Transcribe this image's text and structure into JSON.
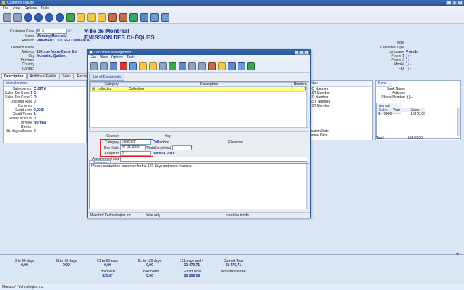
{
  "window": {
    "title": "Customer Inquiry",
    "menu": [
      "File",
      "View",
      "Options",
      "Tools"
    ],
    "status": "Maestro* Technologies inc."
  },
  "customer": {
    "code_label": "Customer Code",
    "code": "MTL",
    "status_label": "Status",
    "status": "Warning Manually",
    "reason_label": "Reason",
    "reason": "PAIEMENT COD RECOMMANDÉ",
    "name": "Ville de Montréal",
    "subtitle": "ÉMISSION DES CHÈQUES",
    "owner_label": "Owner's Name",
    "address_label": "Address",
    "address": "155, rue Notre-Dame Est",
    "city_label": "City",
    "city": "Montréal, Québec",
    "province_label": "Province",
    "country_label": "Country",
    "contact_label": "Contact",
    "note_label": "Note",
    "type_label": "Customer Type",
    "language_label": "Language",
    "language": "French",
    "phone1_label": "Phone 1",
    "phone1": "(   )   -",
    "phone2_label": "Phone 2",
    "phone2": "(   )   -",
    "mobile_label": "Mobile",
    "mobile": "(   )   -",
    "fax_label": "Fax",
    "fax": "(   )   -"
  },
  "tabs": [
    "Description",
    "Additional Fields",
    "Sales",
    "Receipts",
    "Or"
  ],
  "misc": {
    "header": "Miscellaneous",
    "salesperson_label": "Salesperson",
    "salesperson": "CUSTM",
    "taxcode1_label": "Sales Tax Code 1",
    "taxcode1": "C",
    "taxcode2_label": "Sales Tax Code 2",
    "taxcode2": "D",
    "discount_label": "Discount Rate",
    "discount": "0",
    "currency_label": "Currency",
    "credit_label": "Credit Limit",
    "credit": "0,00 $",
    "terms_label": "Credit Terms",
    "terms": "1",
    "account_label": "Default Account",
    "account": "0",
    "invoice_label": "Invoice",
    "invoice": "Normal",
    "region_label": "Region",
    "days_label": "Nb. days allowed",
    "days": "0"
  },
  "numbers": {
    "header": "nber",
    "items": [
      "BQ Number",
      "SST Number",
      "CQ Number",
      "GST Number",
      "PST Number"
    ],
    "dates": [
      "ssation Date",
      "uation Date"
    ]
  },
  "bank": {
    "header": "Bank",
    "name_label": "Bank Name",
    "address_label": "Address",
    "phone_label": "Phone Number",
    "phone": "(   )   -",
    "annual_header": "Annual Sales",
    "col_year": "Year",
    "col_sales": "Sales",
    "row_num": "1",
    "row_year": "2006",
    "row_sales": "19870,00",
    "total_label": "Total",
    "total": "19870,00"
  },
  "aging": {
    "c0_label": "0 to 30 days",
    "c0": "0,00",
    "c1_label": "31 to 60 days",
    "c1": "0,00",
    "c2_label": "61 to 90 days",
    "c2": "0,00",
    "c3_label": "91 to 120 days",
    "c3": "0,00",
    "c4_label": "121 days and +",
    "c4": "21 470,71",
    "c5_label": "Current Total",
    "c5": "21 470,71",
    "holdback_label": "Holdback",
    "holdback": "825,87",
    "onaccount_label": "On Account",
    "onaccount": "0,00",
    "grand_label": "Grand Total",
    "grand": "22 296,58",
    "nontrans_label": "Non-transferred"
  },
  "dialog": {
    "title": "Document Management",
    "menu": [
      "File",
      "View",
      "Options",
      "Tools"
    ],
    "grid_headers": [
      "Category",
      "Description",
      "Number"
    ],
    "row": {
      "category": "collection",
      "description": "Collection",
      "number": "1"
    },
    "list_title": "List of Documents",
    "counter_label": "Counter",
    "key_label": "Key",
    "key": "Collection",
    "category_label": "Category",
    "category": "collection",
    "duedate_label": "Due Date",
    "duedate": "27-01-2009",
    "date_label": "Date",
    "completed_label": "Completed",
    "completed": "- -",
    "assign_label": "Assign to",
    "assign": "0",
    "assign_name": "Isabelle Viau",
    "filename_label": "Filename",
    "assignment_label": "Assignement List",
    "summary_tab": "Summary",
    "summary_text": "Please contact the customer for the 121 days and more invoices.",
    "status_left": "Maestro* Technologies inc.",
    "status_mid": "Note only",
    "status_right": "Insertion mode"
  }
}
